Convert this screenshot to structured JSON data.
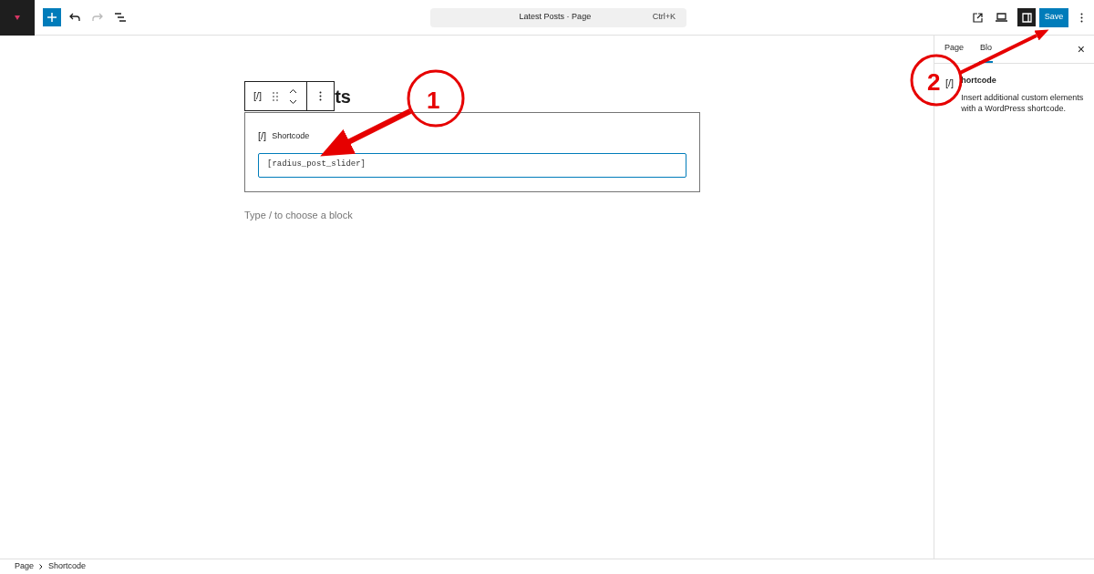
{
  "toolbar": {
    "command_bar": {
      "title": "Latest Posts · Page",
      "shortcut": "Ctrl+K"
    },
    "save_button": "Save",
    "redo_disabled": true,
    "sidebar_toggle_on": true
  },
  "editor": {
    "title": "ts",
    "block_toolbar": {
      "block_icon": "[/]"
    },
    "shortcode_block": {
      "icon": "[/]",
      "label": "Shortcode",
      "value": "[radius_post_slider]"
    },
    "placeholder": "Type / to choose a block"
  },
  "sidebar": {
    "tabs": [
      {
        "label": "Page",
        "selected": false
      },
      {
        "label": "Blo",
        "selected": true
      }
    ],
    "close": "×",
    "block_icon": "[/]",
    "block_name": "hortcode",
    "description": "Insert additional custom elements with a WordPress shortcode."
  },
  "breadcrumb": [
    "Page",
    "Shortcode"
  ],
  "annotations": [
    {
      "label": "1"
    },
    {
      "label": "2"
    }
  ]
}
